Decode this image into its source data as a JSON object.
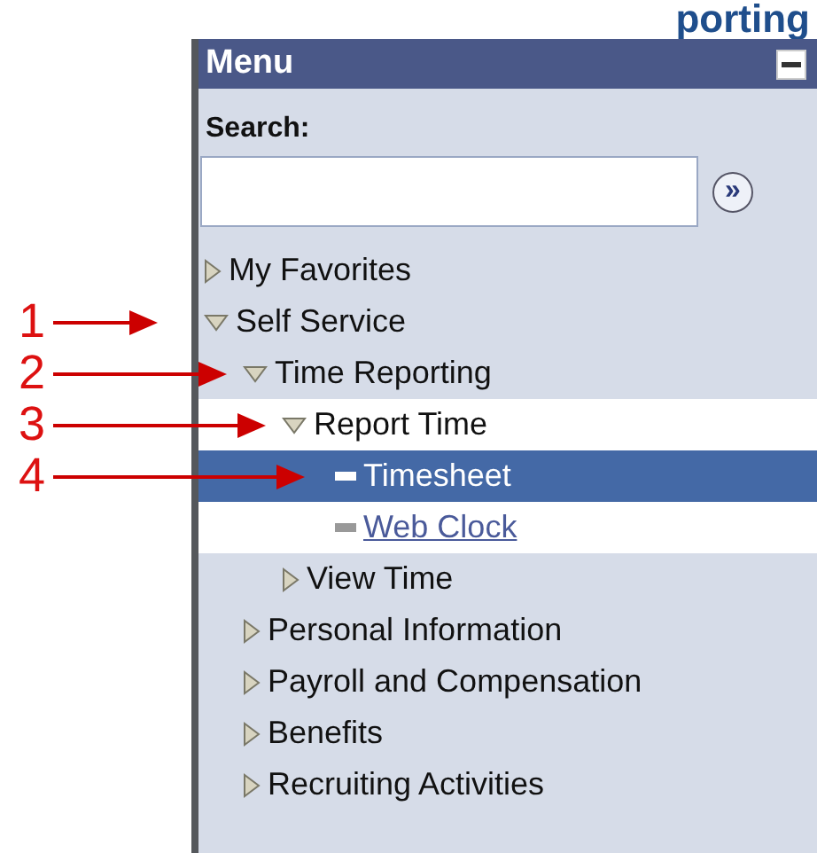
{
  "page_heading": "porting",
  "menu": {
    "title": "Menu",
    "search_label": "Search:",
    "go_symbol": "»"
  },
  "tree": [
    {
      "label": "My Favorites",
      "kind": "folder",
      "expanded": false,
      "selected": false
    },
    {
      "label": "Self Service",
      "kind": "folder",
      "expanded": true,
      "selected": false,
      "callout": "1",
      "children": [
        {
          "label": "Time Reporting",
          "kind": "folder",
          "expanded": true,
          "selected": false,
          "callout": "2",
          "children": [
            {
              "label": "Report Time",
              "kind": "folder",
              "expanded": true,
              "selected": false,
              "callout": "3",
              "children": [
                {
                  "label": "Timesheet",
                  "kind": "page",
                  "selected": true,
                  "callout": "4"
                },
                {
                  "label": "Web Clock",
                  "kind": "page",
                  "selected": false,
                  "link": true
                }
              ]
            },
            {
              "label": "View Time",
              "kind": "folder",
              "expanded": false,
              "selected": false
            }
          ]
        },
        {
          "label": "Personal Information",
          "kind": "folder",
          "expanded": false,
          "selected": false
        },
        {
          "label": "Payroll and Compensation",
          "kind": "folder",
          "expanded": false,
          "selected": false
        },
        {
          "label": "Benefits",
          "kind": "folder",
          "expanded": false,
          "selected": false
        },
        {
          "label": "Recruiting Activities",
          "kind": "folder",
          "expanded": false,
          "selected": false
        }
      ]
    }
  ]
}
